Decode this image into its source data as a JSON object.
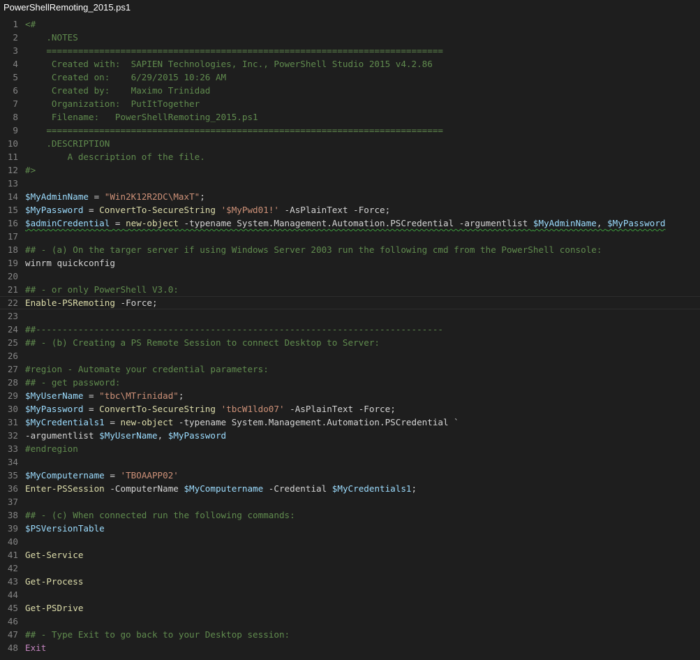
{
  "tab": {
    "title": "PowerShellRemoting_2015.ps1"
  },
  "current_line": 22,
  "colors": {
    "background": "#1e1e1e",
    "line_number": "#858585",
    "comment": "#608b4e",
    "string": "#ce9178",
    "variable": "#9cdcfe",
    "command": "#dcdcaa",
    "keyword": "#c586c0",
    "plain": "#d4d4d4"
  },
  "lines": [
    {
      "n": "1",
      "tokens": [
        {
          "t": "<#",
          "c": "comment"
        }
      ]
    },
    {
      "n": "2",
      "tokens": [
        {
          "t": "    .NOTES",
          "c": "comment"
        }
      ]
    },
    {
      "n": "3",
      "tokens": [
        {
          "t": "    ===========================================================================",
          "c": "comment"
        }
      ]
    },
    {
      "n": "4",
      "tokens": [
        {
          "t": "     Created with:  SAPIEN Technologies, Inc., PowerShell Studio 2015 v4.2.86",
          "c": "comment"
        }
      ]
    },
    {
      "n": "5",
      "tokens": [
        {
          "t": "     Created on:    6/29/2015 10:26 AM",
          "c": "comment"
        }
      ]
    },
    {
      "n": "6",
      "tokens": [
        {
          "t": "     Created by:    Maximo Trinidad",
          "c": "comment"
        }
      ]
    },
    {
      "n": "7",
      "tokens": [
        {
          "t": "     Organization:  PutItTogether",
          "c": "comment"
        }
      ]
    },
    {
      "n": "8",
      "tokens": [
        {
          "t": "     Filename:   PowerShellRemoting_2015.ps1",
          "c": "comment"
        }
      ]
    },
    {
      "n": "9",
      "tokens": [
        {
          "t": "    ===========================================================================",
          "c": "comment"
        }
      ]
    },
    {
      "n": "10",
      "tokens": [
        {
          "t": "    .DESCRIPTION",
          "c": "comment"
        }
      ]
    },
    {
      "n": "11",
      "tokens": [
        {
          "t": "        A description of the file.",
          "c": "comment"
        }
      ]
    },
    {
      "n": "12",
      "tokens": [
        {
          "t": "#>",
          "c": "comment"
        }
      ]
    },
    {
      "n": "13",
      "tokens": []
    },
    {
      "n": "14",
      "tokens": [
        {
          "t": "$MyAdminName",
          "c": "var"
        },
        {
          "t": " = ",
          "c": "op"
        },
        {
          "t": "\"Win2K12R2DC\\MaxT\"",
          "c": "str"
        },
        {
          "t": ";",
          "c": "op"
        }
      ]
    },
    {
      "n": "15",
      "tokens": [
        {
          "t": "$MyPassword",
          "c": "var"
        },
        {
          "t": " = ",
          "c": "op"
        },
        {
          "t": "ConvertTo-SecureString",
          "c": "cmd"
        },
        {
          "t": " ",
          "c": "plain"
        },
        {
          "t": "'$MyPwd01!'",
          "c": "str"
        },
        {
          "t": " -AsPlainText -Force;",
          "c": "param"
        }
      ]
    },
    {
      "n": "16",
      "squiggle": true,
      "tokens": [
        {
          "t": "$adminCredential",
          "c": "var"
        },
        {
          "t": " = ",
          "c": "op"
        },
        {
          "t": "new-object",
          "c": "cmd"
        },
        {
          "t": " -typename System.Management.Automation.PSCredential -argumentlist ",
          "c": "param"
        },
        {
          "t": "$MyAdminName",
          "c": "var"
        },
        {
          "t": ", ",
          "c": "op"
        },
        {
          "t": "$MyPassword",
          "c": "var"
        }
      ]
    },
    {
      "n": "17",
      "tokens": []
    },
    {
      "n": "18",
      "tokens": [
        {
          "t": "## - (a) On the targer server if using Windows Server 2003 run the following cmd from the PowerShell console:",
          "c": "comment"
        }
      ]
    },
    {
      "n": "19",
      "tokens": [
        {
          "t": "winrm quickconfig",
          "c": "plain"
        }
      ]
    },
    {
      "n": "20",
      "tokens": []
    },
    {
      "n": "21",
      "tokens": [
        {
          "t": "## - or only PowerShell V3.0:",
          "c": "comment"
        }
      ]
    },
    {
      "n": "22",
      "tokens": [
        {
          "t": "Enable-PSRemoting",
          "c": "cmd"
        },
        {
          "t": " -Force;",
          "c": "param"
        }
      ]
    },
    {
      "n": "23",
      "tokens": []
    },
    {
      "n": "24",
      "tokens": [
        {
          "t": "##-----------------------------------------------------------------------------",
          "c": "comment"
        }
      ]
    },
    {
      "n": "25",
      "tokens": [
        {
          "t": "## - (b) Creating a PS Remote Session to connect Desktop to Server:",
          "c": "comment"
        }
      ]
    },
    {
      "n": "26",
      "tokens": []
    },
    {
      "n": "27",
      "tokens": [
        {
          "t": "#region - Automate your credential parameters:",
          "c": "comment"
        }
      ]
    },
    {
      "n": "28",
      "tokens": [
        {
          "t": "## - get password:",
          "c": "comment"
        }
      ]
    },
    {
      "n": "29",
      "tokens": [
        {
          "t": "$MyUserName",
          "c": "var"
        },
        {
          "t": " = ",
          "c": "op"
        },
        {
          "t": "\"tbc\\MTrinidad\"",
          "c": "str"
        },
        {
          "t": ";",
          "c": "op"
        }
      ]
    },
    {
      "n": "30",
      "tokens": [
        {
          "t": "$MyPassword",
          "c": "var"
        },
        {
          "t": " = ",
          "c": "op"
        },
        {
          "t": "ConvertTo-SecureString",
          "c": "cmd"
        },
        {
          "t": " ",
          "c": "plain"
        },
        {
          "t": "'tbcW1ldo07'",
          "c": "str"
        },
        {
          "t": " -AsPlainText -Force;",
          "c": "param"
        }
      ]
    },
    {
      "n": "31",
      "tokens": [
        {
          "t": "$MyCredentials1",
          "c": "var"
        },
        {
          "t": " = ",
          "c": "op"
        },
        {
          "t": "new-object",
          "c": "cmd"
        },
        {
          "t": " -typename System.Management.Automation.PSCredential `",
          "c": "param"
        }
      ]
    },
    {
      "n": "32",
      "tokens": [
        {
          "t": "-argumentlist ",
          "c": "param"
        },
        {
          "t": "$MyUserName",
          "c": "var"
        },
        {
          "t": ", ",
          "c": "op"
        },
        {
          "t": "$MyPassword",
          "c": "var"
        }
      ]
    },
    {
      "n": "33",
      "tokens": [
        {
          "t": "#endregion",
          "c": "comment"
        }
      ]
    },
    {
      "n": "34",
      "tokens": []
    },
    {
      "n": "35",
      "tokens": [
        {
          "t": "$MyComputername",
          "c": "var"
        },
        {
          "t": " = ",
          "c": "op"
        },
        {
          "t": "'TBOAAPP02'",
          "c": "str"
        }
      ]
    },
    {
      "n": "36",
      "tokens": [
        {
          "t": "Enter-PSSession",
          "c": "cmd"
        },
        {
          "t": " -ComputerName ",
          "c": "param"
        },
        {
          "t": "$MyComputername",
          "c": "var"
        },
        {
          "t": " -Credential ",
          "c": "param"
        },
        {
          "t": "$MyCredentials1",
          "c": "var"
        },
        {
          "t": ";",
          "c": "op"
        }
      ]
    },
    {
      "n": "37",
      "tokens": []
    },
    {
      "n": "38",
      "tokens": [
        {
          "t": "## - (c) When connected run the following commands:",
          "c": "comment"
        }
      ]
    },
    {
      "n": "39",
      "tokens": [
        {
          "t": "$PSVersionTable",
          "c": "var"
        }
      ]
    },
    {
      "n": "40",
      "tokens": []
    },
    {
      "n": "41",
      "tokens": [
        {
          "t": "Get-Service",
          "c": "cmd"
        }
      ]
    },
    {
      "n": "42",
      "tokens": []
    },
    {
      "n": "43",
      "tokens": [
        {
          "t": "Get-Process",
          "c": "cmd"
        }
      ]
    },
    {
      "n": "44",
      "tokens": []
    },
    {
      "n": "45",
      "tokens": [
        {
          "t": "Get-PSDrive",
          "c": "cmd"
        }
      ]
    },
    {
      "n": "46",
      "tokens": []
    },
    {
      "n": "47",
      "tokens": [
        {
          "t": "## - Type Exit to go back to your Desktop session:",
          "c": "comment"
        }
      ]
    },
    {
      "n": "48",
      "tokens": [
        {
          "t": "Exit",
          "c": "kw"
        }
      ]
    }
  ]
}
